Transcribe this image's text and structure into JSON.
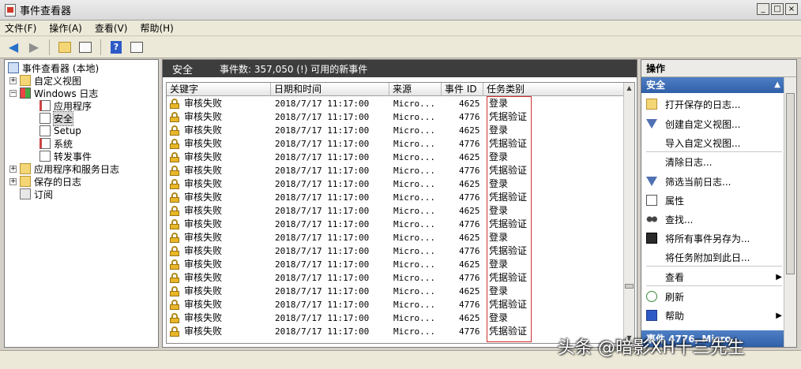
{
  "window": {
    "title": "事件查看器"
  },
  "menu": [
    "文件(F)",
    "操作(A)",
    "查看(V)",
    "帮助(H)"
  ],
  "tree": {
    "root": "事件查看器 (本地)",
    "custom_views": "自定义视图",
    "windows_logs": "Windows 日志",
    "application": "应用程序",
    "security": "安全",
    "setup": "Setup",
    "system": "系统",
    "forwarded": "转发事件",
    "app_service_logs": "应用程序和服务日志",
    "saved_logs": "保存的日志",
    "subscriptions": "订阅"
  },
  "center": {
    "title": "安全",
    "event_count": "事件数: 357,050 (!) 可用的新事件"
  },
  "grid": {
    "columns": [
      "关键字",
      "日期和时间",
      "来源",
      "事件 ID",
      "任务类别"
    ],
    "rows": [
      {
        "keyword": "审核失败",
        "datetime": "2018/7/17 11:17:00",
        "source": "Micro...",
        "id": "4625",
        "category": "登录"
      },
      {
        "keyword": "审核失败",
        "datetime": "2018/7/17 11:17:00",
        "source": "Micro...",
        "id": "4776",
        "category": "凭据验证"
      },
      {
        "keyword": "审核失败",
        "datetime": "2018/7/17 11:17:00",
        "source": "Micro...",
        "id": "4625",
        "category": "登录"
      },
      {
        "keyword": "审核失败",
        "datetime": "2018/7/17 11:17:00",
        "source": "Micro...",
        "id": "4776",
        "category": "凭据验证"
      },
      {
        "keyword": "审核失败",
        "datetime": "2018/7/17 11:17:00",
        "source": "Micro...",
        "id": "4625",
        "category": "登录"
      },
      {
        "keyword": "审核失败",
        "datetime": "2018/7/17 11:17:00",
        "source": "Micro...",
        "id": "4776",
        "category": "凭据验证"
      },
      {
        "keyword": "审核失败",
        "datetime": "2018/7/17 11:17:00",
        "source": "Micro...",
        "id": "4625",
        "category": "登录"
      },
      {
        "keyword": "审核失败",
        "datetime": "2018/7/17 11:17:00",
        "source": "Micro...",
        "id": "4776",
        "category": "凭据验证"
      },
      {
        "keyword": "审核失败",
        "datetime": "2018/7/17 11:17:00",
        "source": "Micro...",
        "id": "4625",
        "category": "登录"
      },
      {
        "keyword": "审核失败",
        "datetime": "2018/7/17 11:17:00",
        "source": "Micro...",
        "id": "4776",
        "category": "凭据验证"
      },
      {
        "keyword": "审核失败",
        "datetime": "2018/7/17 11:17:00",
        "source": "Micro...",
        "id": "4625",
        "category": "登录"
      },
      {
        "keyword": "审核失败",
        "datetime": "2018/7/17 11:17:00",
        "source": "Micro...",
        "id": "4776",
        "category": "凭据验证"
      },
      {
        "keyword": "审核失败",
        "datetime": "2018/7/17 11:17:00",
        "source": "Micro...",
        "id": "4625",
        "category": "登录"
      },
      {
        "keyword": "审核失败",
        "datetime": "2018/7/17 11:17:00",
        "source": "Micro...",
        "id": "4776",
        "category": "凭据验证"
      },
      {
        "keyword": "审核失败",
        "datetime": "2018/7/17 11:17:00",
        "source": "Micro...",
        "id": "4625",
        "category": "登录"
      },
      {
        "keyword": "审核失败",
        "datetime": "2018/7/17 11:17:00",
        "source": "Micro...",
        "id": "4776",
        "category": "凭据验证"
      },
      {
        "keyword": "审核失败",
        "datetime": "2018/7/17 11:17:00",
        "source": "Micro...",
        "id": "4625",
        "category": "登录"
      },
      {
        "keyword": "审核失败",
        "datetime": "2018/7/17 11:17:00",
        "source": "Micro...",
        "id": "4776",
        "category": "凭据验证"
      }
    ]
  },
  "actions": {
    "header": "操作",
    "section": "安全",
    "items": [
      "打开保存的日志...",
      "创建自定义视图...",
      "导入自定义视图...",
      "清除日志...",
      "筛选当前日志...",
      "属性",
      "查找...",
      "将所有事件另存为...",
      "将任务附加到此日...",
      "查看",
      "刷新",
      "帮助"
    ],
    "bottom_section": "事件 4776, Micro..."
  },
  "watermark": "头条 @暗影XH十三先生",
  "colors": {
    "highlight_box": "#d23030",
    "action_section": "#2e5fa8",
    "title_dark": "#3d3d3d"
  }
}
